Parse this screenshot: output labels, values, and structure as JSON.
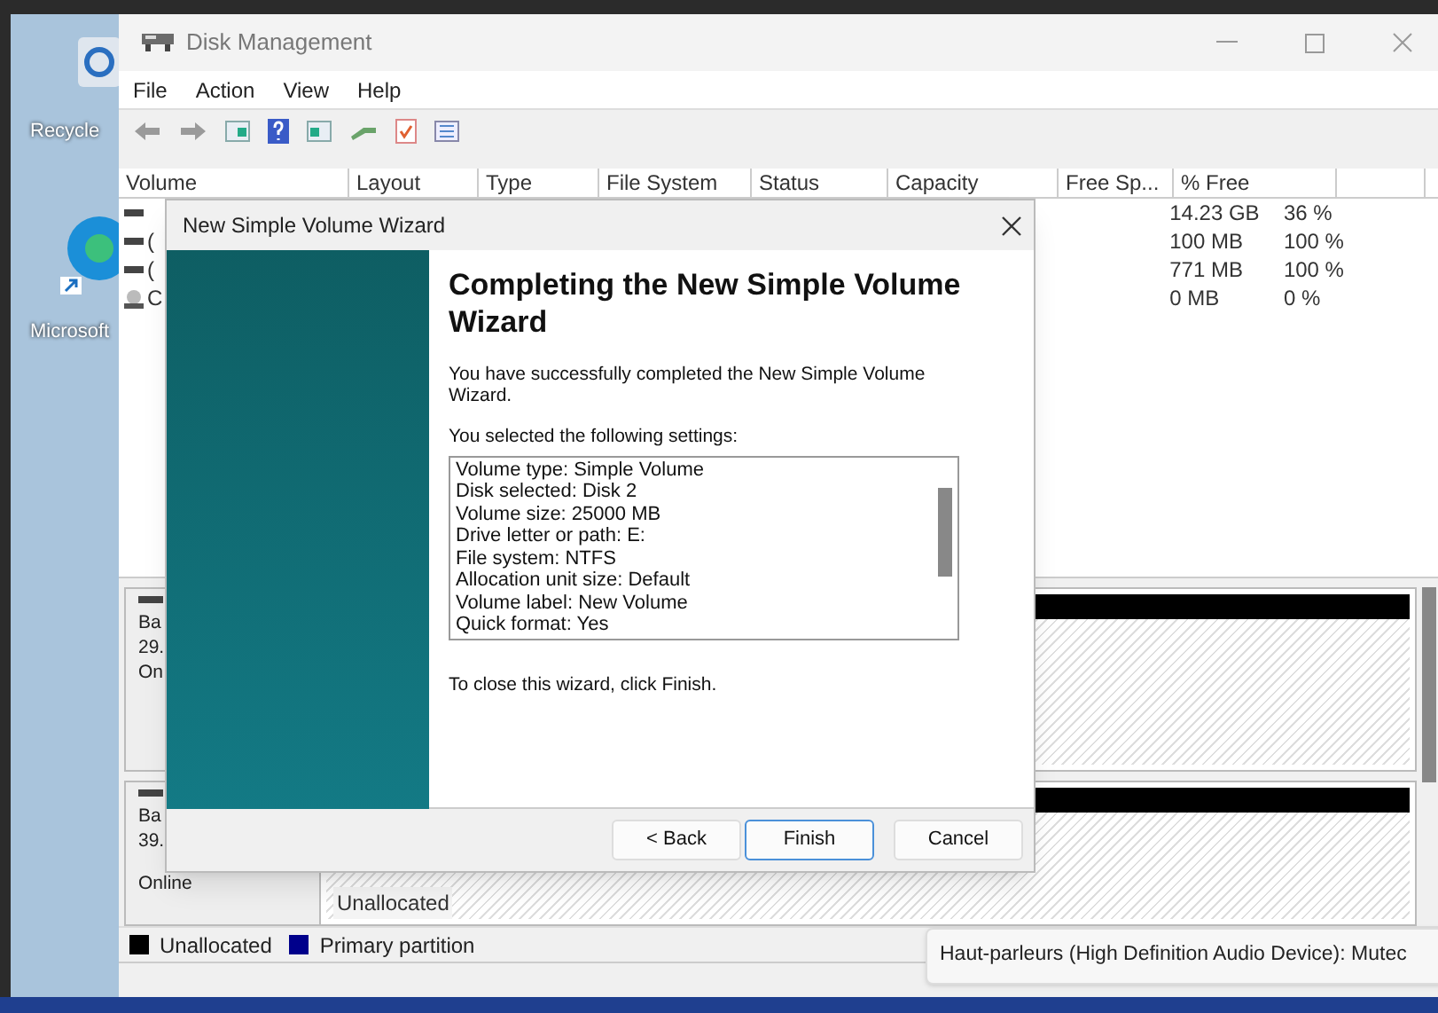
{
  "desktop": {
    "icons": [
      {
        "label": "Recycle"
      },
      {
        "label": "Microsoft"
      }
    ]
  },
  "window": {
    "title": "Disk Management"
  },
  "menu": [
    "File",
    "Action",
    "View",
    "Help"
  ],
  "volume_table": {
    "columns": [
      "Volume",
      "Layout",
      "Type",
      "File System",
      "Status",
      "Capacity",
      "Free Sp...",
      "% Free"
    ],
    "rows": [
      {
        "free_space": "14.23 GB",
        "percent_free": "36 %"
      },
      {
        "volume": "(",
        "free_space": "100 MB",
        "percent_free": "100 %"
      },
      {
        "volume": "(",
        "free_space": "771 MB",
        "percent_free": "100 %"
      },
      {
        "volume": "C",
        "free_space": "0 MB",
        "percent_free": "0 %"
      }
    ]
  },
  "disks": [
    {
      "lines": [
        "Ba",
        "29.",
        "On"
      ]
    },
    {
      "lines": [
        "Ba",
        "39.",
        "Online"
      ],
      "partition": "Unallocated"
    }
  ],
  "legend": [
    {
      "label": "Unallocated",
      "color": "#000000"
    },
    {
      "label": "Primary partition",
      "color": "#00008b"
    }
  ],
  "wizard": {
    "title": "New Simple Volume Wizard",
    "heading": "Completing the New Simple Volume Wizard",
    "intro": "You have successfully completed the New Simple Volume Wizard.",
    "settings_label": "You selected the following settings:",
    "settings": [
      "Volume type: Simple Volume",
      "Disk selected: Disk 2",
      "Volume size: 25000 MB",
      "Drive letter or path: E:",
      "File system: NTFS",
      "Allocation unit size: Default",
      "Volume label: New Volume",
      "Quick format: Yes"
    ],
    "closing_note": "To close this wizard, click Finish.",
    "buttons": [
      {
        "label": "< Back",
        "default": false
      },
      {
        "label": "Finish",
        "default": true
      },
      {
        "label": "Cancel",
        "default": false
      }
    ]
  },
  "tooltip": {
    "text": "Haut-parleurs (High Definition Audio Device): Mutec"
  }
}
